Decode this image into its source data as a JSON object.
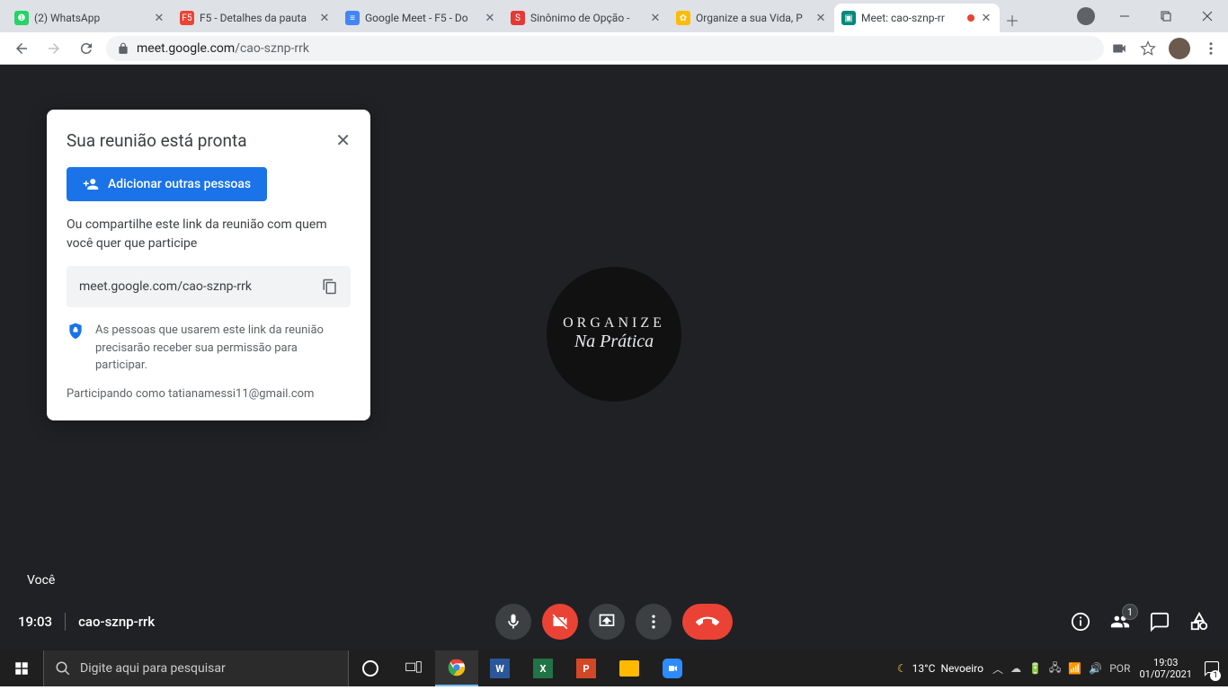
{
  "browser": {
    "tabs": [
      {
        "title": "(2) WhatsApp",
        "favicon_bg": "#25d366"
      },
      {
        "title": "F5 - Detalhes da pauta",
        "favicon_bg": "#ea4335"
      },
      {
        "title": "Google Meet - F5 - Do",
        "favicon_bg": "#4285f4"
      },
      {
        "title": "Sinônimo de Opção - ",
        "favicon_bg": "#e53935"
      },
      {
        "title": "Organize a sua Vida, P",
        "favicon_bg": "#fbbc04"
      },
      {
        "title": "Meet: cao-sznp-rr",
        "favicon_bg": "#00897b",
        "active": true,
        "recording": true
      }
    ],
    "url_host": "meet.google.com",
    "url_path": "/cao-sznp-rrk"
  },
  "meet": {
    "self_label": "Você",
    "avatar_line1": "ORGANIZE",
    "avatar_line2": "Na Prática",
    "time": "19:03",
    "code": "cao-sznp-rrk",
    "participants_badge": "1"
  },
  "popup": {
    "title": "Sua reunião está pronta",
    "add_button": "Adicionar outras pessoas",
    "share_text": "Ou compartilhe este link da reunião com quem você quer que participe",
    "link": "meet.google.com/cao-sznp-rrk",
    "info_text": "As pessoas que usarem este link da reunião precisarão receber sua permissão para participar.",
    "joining_as": "Participando como tatianamessi11@gmail.com"
  },
  "taskbar": {
    "search_placeholder": "Digite aqui para pesquisar",
    "weather_temp": "13°C",
    "weather_cond": "Nevoeiro",
    "lang": "POR",
    "clock_time": "19:03",
    "clock_date": "01/07/2021"
  }
}
